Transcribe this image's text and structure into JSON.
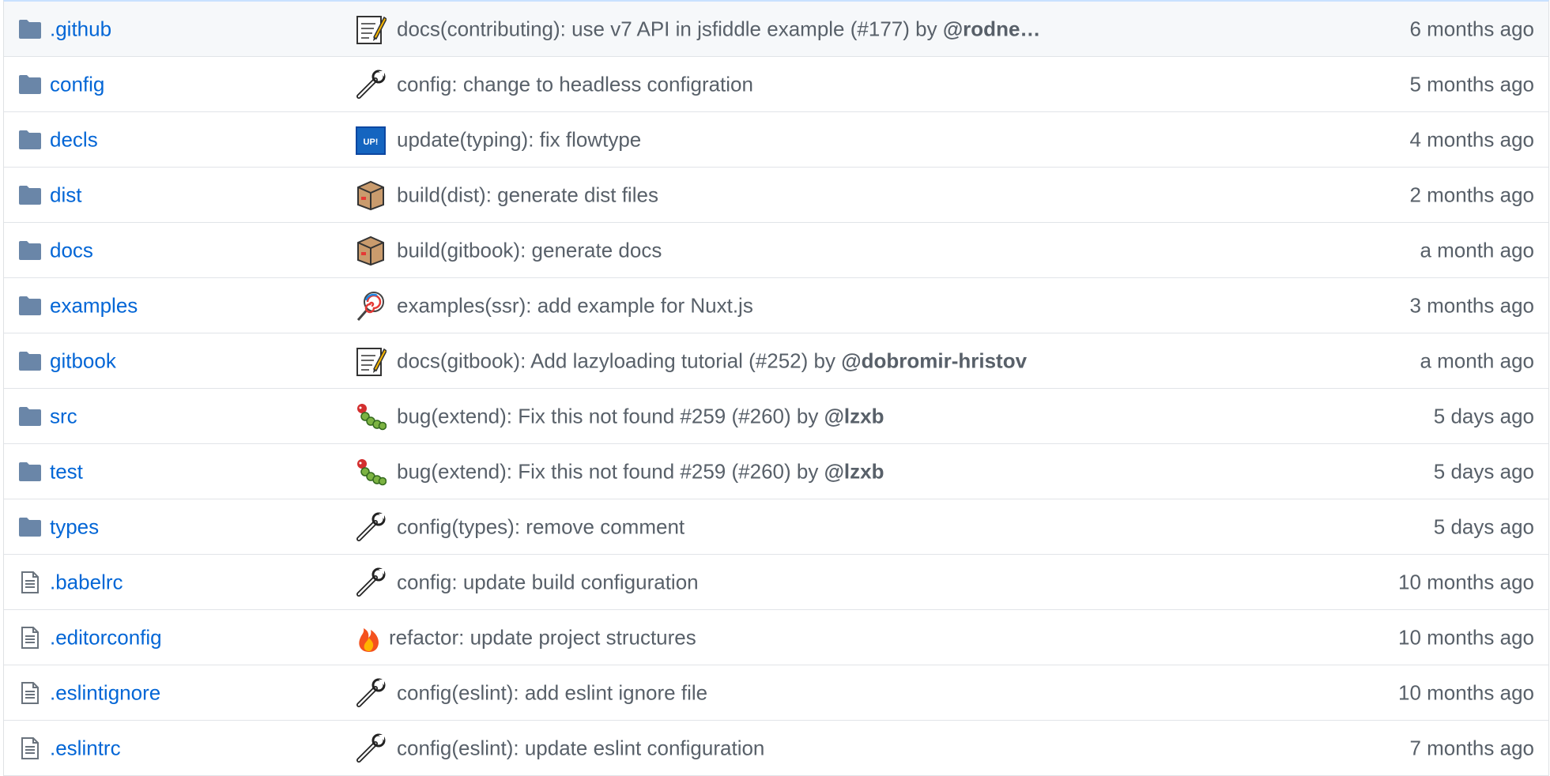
{
  "colors": {
    "link": "#0366d6",
    "muted": "#586069",
    "folder": "#79b8ff",
    "row_highlight": "#f6f8fa",
    "border": "#e1e4e8"
  },
  "rows": [
    {
      "type": "folder",
      "icon": "folder-icon",
      "name": ".github",
      "commit_icon": "memo-icon",
      "message": "docs(contributing): use v7 API in jsfiddle example (#177)",
      "by": " by ",
      "user": "@rodne…",
      "age": "6 months ago"
    },
    {
      "type": "folder",
      "icon": "folder-icon",
      "name": "config",
      "commit_icon": "wrench-icon",
      "message": "config: change to headless configration",
      "by": "",
      "user": "",
      "age": "5 months ago"
    },
    {
      "type": "folder",
      "icon": "folder-icon",
      "name": "decls",
      "commit_icon": "up-icon",
      "up_label": "UP!",
      "message": "update(typing): fix flowtype",
      "by": "",
      "user": "",
      "age": "4 months ago"
    },
    {
      "type": "folder",
      "icon": "folder-icon",
      "name": "dist",
      "commit_icon": "package-icon",
      "message": "build(dist): generate dist files",
      "by": "",
      "user": "",
      "age": "2 months ago"
    },
    {
      "type": "folder",
      "icon": "folder-icon",
      "name": "docs",
      "commit_icon": "package-icon",
      "message": "build(gitbook): generate docs",
      "by": "",
      "user": "",
      "age": "a month ago"
    },
    {
      "type": "folder",
      "icon": "folder-icon",
      "name": "examples",
      "commit_icon": "lollipop-icon",
      "message": "examples(ssr): add example for Nuxt.js",
      "by": "",
      "user": "",
      "age": "3 months ago"
    },
    {
      "type": "folder",
      "icon": "folder-icon",
      "name": "gitbook",
      "commit_icon": "memo-icon",
      "message": "docs(gitbook): Add lazyloading tutorial (#252)",
      "by": " by ",
      "user": "@dobromir-hristov",
      "age": "a month ago"
    },
    {
      "type": "folder",
      "icon": "folder-icon",
      "name": "src",
      "commit_icon": "bug-icon",
      "message": "bug(extend): Fix this not found #259 (#260)",
      "by": " by ",
      "user": "@lzxb",
      "age": "5 days ago"
    },
    {
      "type": "folder",
      "icon": "folder-icon",
      "name": "test",
      "commit_icon": "bug-icon",
      "message": "bug(extend): Fix this not found #259 (#260)",
      "by": " by ",
      "user": "@lzxb",
      "age": "5 days ago"
    },
    {
      "type": "folder",
      "icon": "folder-icon",
      "name": "types",
      "commit_icon": "wrench-icon",
      "message": "config(types): remove comment",
      "by": "",
      "user": "",
      "age": "5 days ago"
    },
    {
      "type": "file",
      "icon": "file-icon",
      "name": ".babelrc",
      "commit_icon": "wrench-icon",
      "message": "config: update build configuration",
      "by": "",
      "user": "",
      "age": "10 months ago"
    },
    {
      "type": "file",
      "icon": "file-icon",
      "name": ".editorconfig",
      "commit_icon": "fire-icon",
      "message": "refactor: update project structures",
      "by": "",
      "user": "",
      "age": "10 months ago"
    },
    {
      "type": "file",
      "icon": "file-icon",
      "name": ".eslintignore",
      "commit_icon": "wrench-icon",
      "message": "config(eslint): add eslint ignore file",
      "by": "",
      "user": "",
      "age": "10 months ago"
    },
    {
      "type": "file",
      "icon": "file-icon",
      "name": ".eslintrc",
      "commit_icon": "wrench-icon",
      "message": "config(eslint): update eslint configuration",
      "by": "",
      "user": "",
      "age": "7 months ago"
    }
  ]
}
